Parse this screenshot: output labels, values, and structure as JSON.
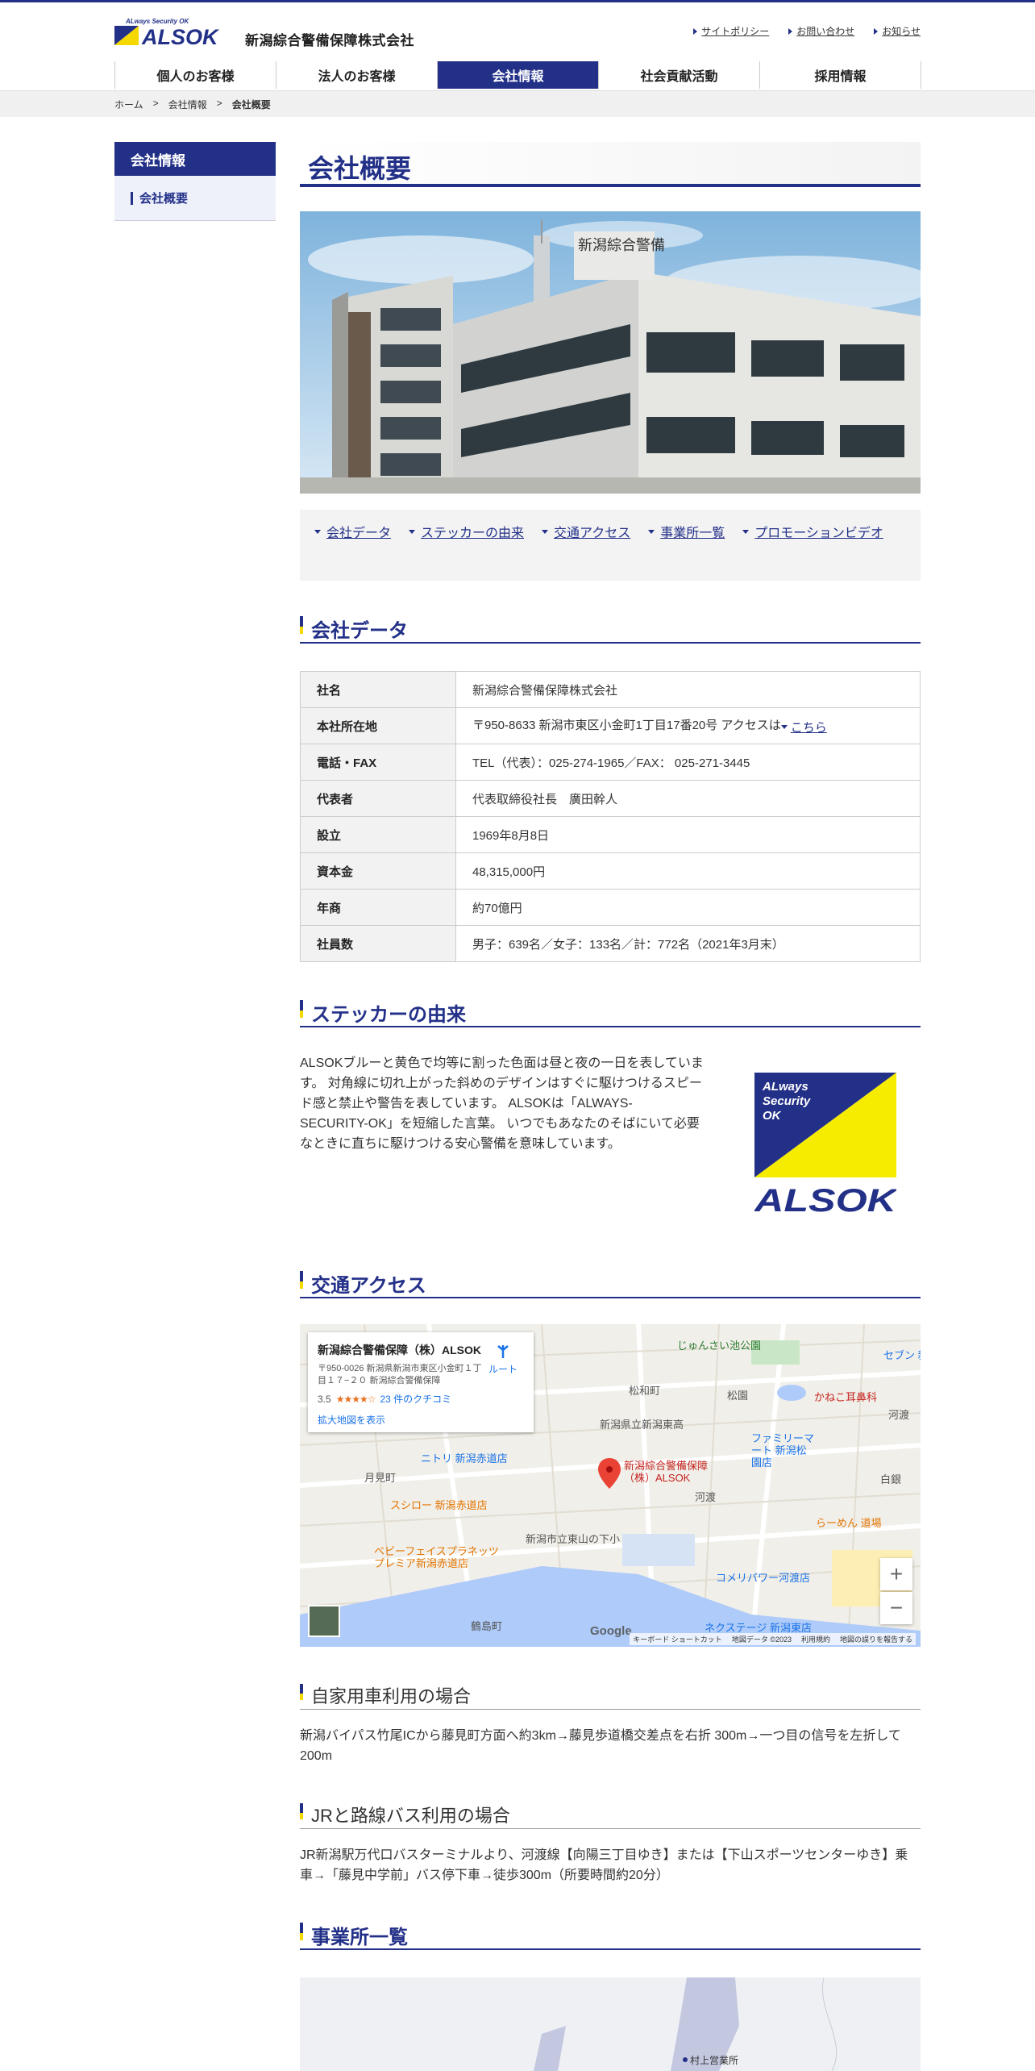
{
  "header": {
    "logo_tagline": "ALways Security OK",
    "logo_text": "ALSOK",
    "company_name": "新潟綜合警備保障株式会社",
    "util_links": [
      "サイトポリシー",
      "お問い合わせ",
      "お知らせ"
    ]
  },
  "nav": [
    {
      "label": "個人のお客様"
    },
    {
      "label": "法人のお客様"
    },
    {
      "label": "会社情報"
    },
    {
      "label": "社会貢献活動"
    },
    {
      "label": "採用情報"
    }
  ],
  "breadcrumb": [
    "ホーム",
    ">",
    "会社情報",
    ">",
    "会社概要"
  ],
  "side": {
    "heading": "会社情報",
    "item": "会社概要"
  },
  "page_title": "会社概要",
  "photo": {
    "sign_text": "新潟綜合警備"
  },
  "anchors": [
    "会社データ",
    "ステッカーの由来",
    "交通アクセス",
    "事業所一覧",
    "プロモーションビデオ"
  ],
  "company": {
    "title": "会社データ",
    "rows": [
      {
        "k": "社名",
        "v": "新潟綜合警備保障株式会社"
      },
      {
        "k": "本社所在地",
        "v": "〒950-8633 新潟市東区小金町1丁目17番20号 アクセスは",
        "link": "こちら"
      },
      {
        "k": "電話・FAX",
        "v": "TEL（代表）：025-274-1965／FAX： 025-271-3445"
      },
      {
        "k": "代表者",
        "v": "代表取締役社長　廣田幹人"
      },
      {
        "k": "設立",
        "v": "1969年8月8日"
      },
      {
        "k": "資本金",
        "v": "48,315,000円"
      },
      {
        "k": "年商",
        "v": "約70億円"
      },
      {
        "k": "社員数",
        "v": "男子：639名／女子：133名／計：772名（2021年3月末）"
      }
    ]
  },
  "sticker": {
    "title": "ステッカーの由来",
    "lines": [
      "ALSOKブルーと黄色で均等に割った色面は昼と夜の一日を表していま",
      "す。 対角線に切れ上がった斜めのデザインはすぐに駆けつけるスピー",
      "ド感と禁止や警告を表しています。 ALSOKは「ALWAYS-",
      "SECURITY-OK」を短縮した言葉。 いつでもあなたのそばにいて必要",
      "なときに直ちに駆けつける安心警備を意味しています。"
    ],
    "logo_lines": [
      "ALways",
      "Security",
      "OK"
    ],
    "logo_word": "ALSOK"
  },
  "access": {
    "title": "交通アクセス",
    "map_card": {
      "name": "新潟綜合警備保障（株）ALSOK",
      "addr": "〒950-0026 新潟県新潟市東区小金町１丁目１７−２０ 新潟綜合警備保障",
      "rating": "3.5",
      "stars": "★★★★☆",
      "reviews": "23 件のクチコミ",
      "big_map": "拡大地図を表示",
      "route": "ルート"
    },
    "map_labels": [
      "じゅんさい池公園",
      "松和町",
      "松園",
      "かねこ耳鼻科",
      "新潟県立新潟東高",
      "ファミリーマート 新潟松園店",
      "ニトリ 新潟赤道店",
      "新潟綜合警備保障（株）ALSOK",
      "月見町",
      "河渡",
      "白銀",
      "スシロー 新潟赤道店",
      "らーめん 道場",
      "新潟市立東山の下小",
      "ベビーフェイスプラネッツ プレミア新潟赤道店",
      "コメリパワー河渡店",
      "ネクステージ 新潟東店",
      "鶴島町",
      "セブン 新潟",
      "河渡"
    ],
    "map_footer": [
      "キーボード ショートカット",
      "地図データ ©2023",
      "利用規約",
      "地図の誤りを報告する"
    ],
    "google": "Google",
    "car_title": "自家用車利用の場合",
    "car_lines": [
      "新潟バイパス竹尾ICから藤見町方面へ約3km→藤見歩道橋交差点を右折 300m→一つ目の信号を左折して",
      "200m"
    ],
    "bus_title": "JRと路線バス利用の場合",
    "bus_lines": [
      "JR新潟駅万代口バスターミナルより、河渡線【向陽三丁目ゆき】または【下山スポーツセンターゆき】乗",
      "車→「藤見中学前」バス停下車→徒歩300m（所要時間約20分）"
    ]
  },
  "offices": {
    "title": "事業所一覧",
    "map_label": "村上営業所"
  },
  "colors": {
    "brand": "#233088",
    "yellow": "#f5d800"
  }
}
